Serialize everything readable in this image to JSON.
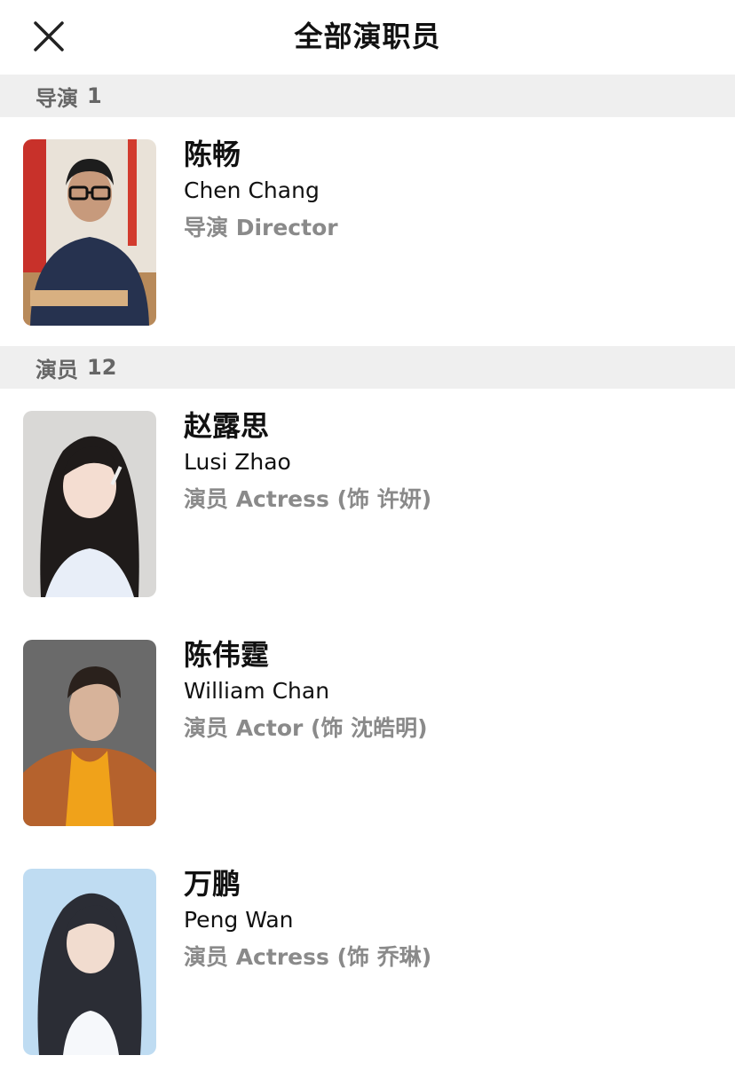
{
  "header": {
    "title": "全部演职员"
  },
  "sections": [
    {
      "label": "导演",
      "count": "1"
    },
    {
      "label": "演员",
      "count": "12"
    }
  ],
  "people": [
    {
      "cn": "陈畅",
      "en": "Chen Chang",
      "role": "导演 Director"
    },
    {
      "cn": "赵露思",
      "en": "Lusi Zhao",
      "role": "演员 Actress (饰 许妍)"
    },
    {
      "cn": "陈伟霆",
      "en": "William Chan",
      "role": "演员 Actor (饰 沈皓明)"
    },
    {
      "cn": "万鹏",
      "en": "Peng Wan",
      "role": "演员 Actress (饰 乔琳)"
    }
  ]
}
